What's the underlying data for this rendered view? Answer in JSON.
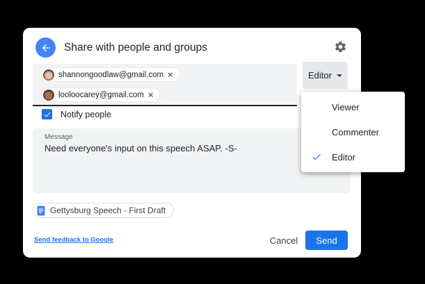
{
  "dialog": {
    "title": "Share with people and groups",
    "recipients": [
      {
        "email": "shannongoodlaw@gmail.com"
      },
      {
        "email": "looloocarey@gmail.com"
      }
    ],
    "role_button": {
      "label": "Editor"
    },
    "role_menu": {
      "items": [
        {
          "label": "Viewer",
          "selected": false
        },
        {
          "label": "Commenter",
          "selected": false
        },
        {
          "label": "Editor",
          "selected": true
        }
      ]
    },
    "notify": {
      "label": "Notify people",
      "checked": true
    },
    "message": {
      "label": "Message",
      "value": "Need everyone's input on this speech ASAP. -S-"
    },
    "document_chip": {
      "label": "Gettysburg Speech - First Draft"
    },
    "footer": {
      "feedback_link": "Send feedback to Google",
      "cancel_label": "Cancel",
      "send_label": "Send"
    }
  },
  "icons": {
    "close_glyph": "×",
    "names": [
      "back-arrow-icon",
      "gear-icon",
      "close-icon",
      "caret-down-icon",
      "check-icon",
      "checkbox-check-icon",
      "doc-icon"
    ]
  },
  "colors": {
    "background": "#000000",
    "dialog_bg": "#ffffff",
    "field_bg": "#f1f3f4",
    "role_button_bg": "#e6e8eb",
    "accent_blue": "#1a73e8",
    "back_circle_blue": "#4285f4",
    "check_blue": "#4285f4",
    "text_primary": "#202124",
    "text_secondary": "#5f6368",
    "chip_border": "#dadce0"
  }
}
